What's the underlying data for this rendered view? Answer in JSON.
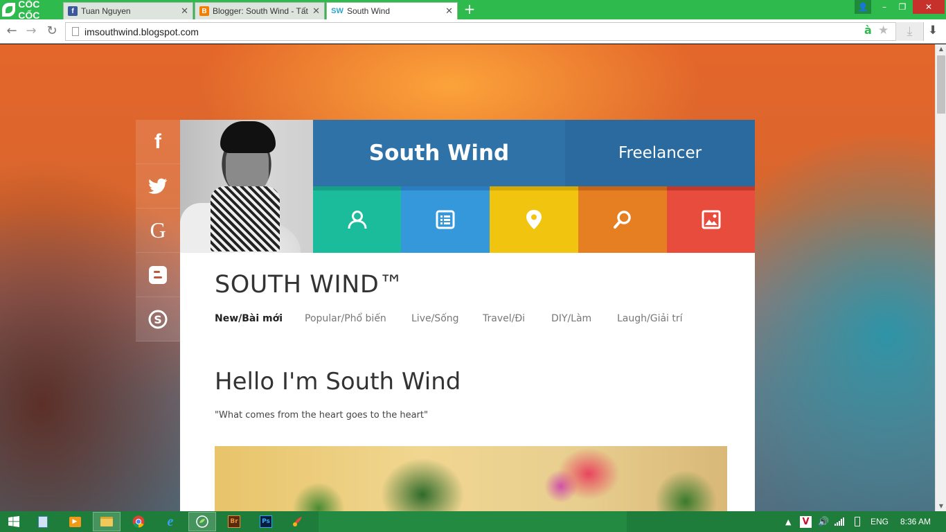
{
  "browser": {
    "name": "CỐC CỐC",
    "tabs": [
      {
        "label": "Tuan Nguyen",
        "favicon": "f",
        "favicon_color": "#3b5998"
      },
      {
        "label": "Blogger: South Wind - Tất",
        "favicon": "B",
        "favicon_color": "#f57d00"
      },
      {
        "label": "South Wind",
        "favicon": "SW",
        "favicon_color": "#2ba6cb"
      }
    ],
    "new_tab": "+",
    "url": "imsouthwind.blogspot.com",
    "window_controls": {
      "minimize": "–",
      "restore": "❐",
      "close": "✕"
    }
  },
  "site": {
    "name": "South Wind",
    "tagline": "Freelancer",
    "social": [
      "facebook-icon",
      "twitter-icon",
      "google-plus-icon",
      "blogger-icon",
      "skype-icon"
    ],
    "social_glyphs": [
      "f",
      "t",
      "G",
      "b",
      "S"
    ],
    "tiles": [
      {
        "icon": "user-icon",
        "color": "#1abc9c",
        "stripe": "#16a085"
      },
      {
        "icon": "list-icon",
        "color": "#3498db",
        "stripe": "#2b7cc0"
      },
      {
        "icon": "location-icon",
        "color": "#f1c40f",
        "stripe": "#d4aa05"
      },
      {
        "icon": "search-icon",
        "color": "#e67e22",
        "stripe": "#c86617"
      },
      {
        "icon": "image-icon",
        "color": "#e74c3c",
        "stripe": "#c0392b"
      }
    ],
    "blog_title": "SOUTH WIND™",
    "menu": [
      {
        "label": "New/Bài mới",
        "active": true
      },
      {
        "label": "Popular/Phổ biến",
        "active": false
      },
      {
        "label": "Live/Sống",
        "active": false
      },
      {
        "label": "Travel/Đi",
        "active": false
      },
      {
        "label": "DIY/Làm",
        "active": false
      },
      {
        "label": "Laugh/Giải trí",
        "active": false
      }
    ],
    "heading": "Hello I'm South Wind",
    "quote": "\"What comes from the heart goes to the heart\""
  },
  "taskbar": {
    "language": "ENG",
    "time": "8:36 AM",
    "apps": [
      "start-icon",
      "notepad-icon",
      "media-player-icon",
      "file-explorer-icon",
      "chrome-icon",
      "internet-explorer-icon",
      "coccoc-icon",
      "bridge-icon",
      "photoshop-icon",
      "paint-icon"
    ],
    "app_labels": {
      "bridge": "Br",
      "photoshop": "Ps"
    }
  }
}
